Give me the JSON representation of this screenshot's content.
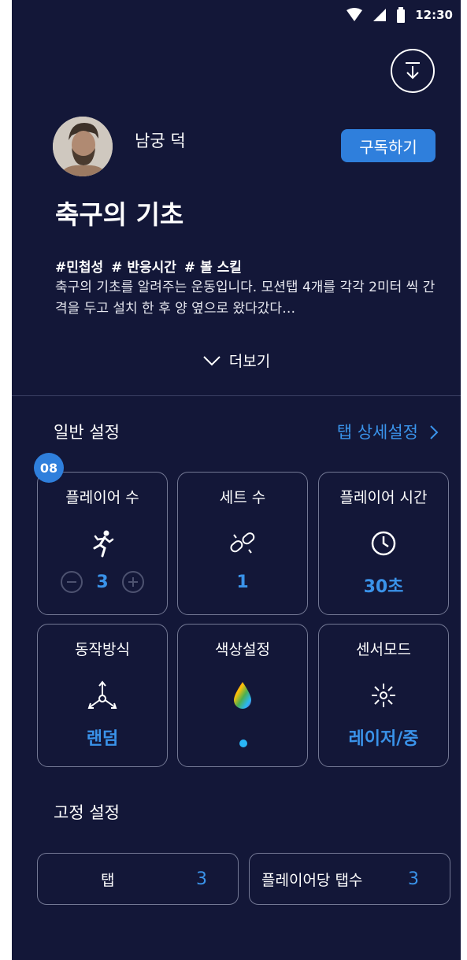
{
  "status_bar": {
    "time": "12:30"
  },
  "author": {
    "name": "남궁 덕"
  },
  "subscribe_label": "구독하기",
  "title": "축구의 기초",
  "tags": [
    "#민첩성",
    "# 반응시간",
    "# 볼 스킬"
  ],
  "description": "축구의 기초를 알려주는 운동입니다. 모션탭 4개를 각각 2미터 씩 간격을 두고 설치 한 후 양 옆으로 왔다갔다…",
  "more_label": "더보기",
  "general_settings": {
    "label": "일반 설정",
    "detail_link": "탭 상세설정",
    "badge": "08",
    "cards": [
      {
        "label": "플레이어 수",
        "value": "3",
        "icon": "running-person-icon"
      },
      {
        "label": "세트 수",
        "value": "1",
        "icon": "chain-link-icon"
      },
      {
        "label": "플레이어 시간",
        "value": "30초",
        "icon": "clock-icon"
      },
      {
        "label": "동작방식",
        "value": "랜덤",
        "icon": "random-directions-icon"
      },
      {
        "label": "색상설정",
        "value": "",
        "icon": "rainbow-drop-icon",
        "selected_color": "#29b6f6"
      },
      {
        "label": "센서모드",
        "value": "레이저/중",
        "icon": "laser-sensor-icon"
      }
    ]
  },
  "fixed_settings": {
    "label": "고정 설정",
    "items": [
      {
        "label": "탭",
        "value": "3"
      },
      {
        "label": "플레이어당 탭수",
        "value": "3"
      }
    ]
  },
  "colors": {
    "background": "#131738",
    "accent": "#3a93ea",
    "button": "#2f7fdc"
  }
}
